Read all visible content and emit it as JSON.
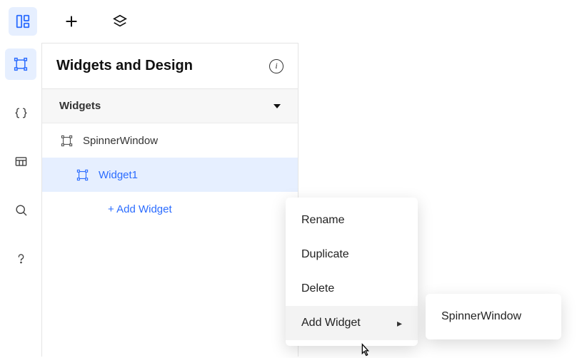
{
  "topbar": {
    "dashboard_icon": "dashboard",
    "add_icon": "plus",
    "layers_icon": "layers"
  },
  "left_rail": {
    "items": [
      {
        "icon": "widget-frame",
        "active": true
      },
      {
        "icon": "braces",
        "active": false
      },
      {
        "icon": "table",
        "active": false
      },
      {
        "icon": "search",
        "active": false
      },
      {
        "icon": "help",
        "active": false
      }
    ]
  },
  "panel": {
    "title": "Widgets and Design",
    "info_label": "i",
    "section": {
      "label": "Widgets"
    },
    "tree": [
      {
        "label": "SpinnerWindow",
        "selected": false
      },
      {
        "label": "Widget1",
        "selected": true
      }
    ],
    "add_widget_label": "+ Add Widget"
  },
  "context_menu": {
    "items": [
      {
        "label": "Rename",
        "has_submenu": false
      },
      {
        "label": "Duplicate",
        "has_submenu": false
      },
      {
        "label": "Delete",
        "has_submenu": false
      },
      {
        "label": "Add Widget",
        "has_submenu": true,
        "hover": true
      }
    ]
  },
  "submenu": {
    "items": [
      {
        "label": "SpinnerWindow"
      }
    ]
  }
}
